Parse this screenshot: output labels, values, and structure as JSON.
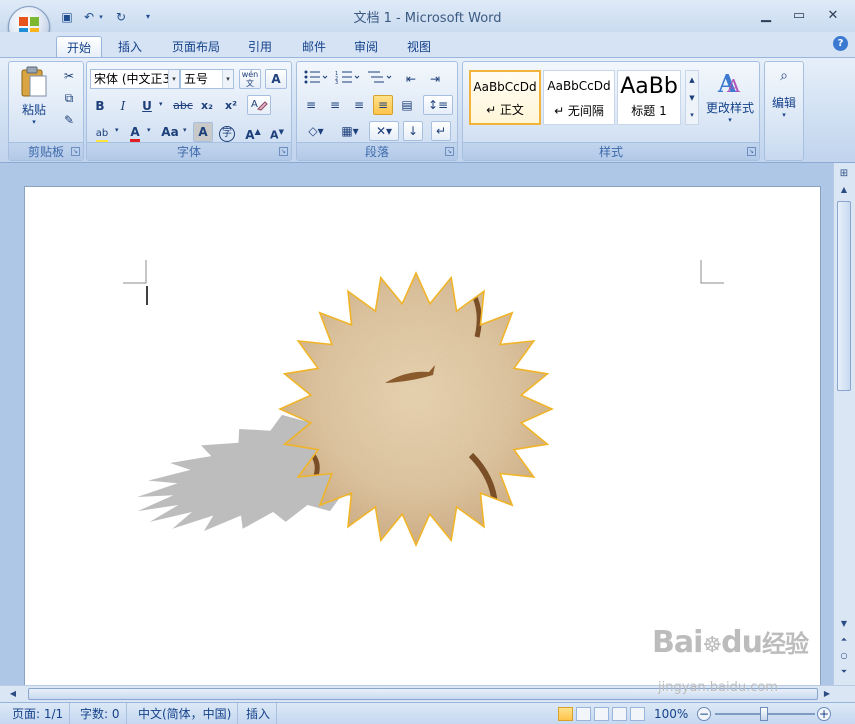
{
  "window": {
    "title": "文档 1 - Microsoft Word"
  },
  "tabs": [
    {
      "label": "开始",
      "active": true
    },
    {
      "label": "插入"
    },
    {
      "label": "页面布局"
    },
    {
      "label": "引用"
    },
    {
      "label": "邮件"
    },
    {
      "label": "审阅"
    },
    {
      "label": "视图"
    }
  ],
  "ribbon": {
    "clipboard": {
      "group_label": "剪贴板",
      "paste_label": "粘贴"
    },
    "font": {
      "group_label": "字体",
      "font_name": "宋体 (中文正3",
      "font_size": "五号",
      "bold": "B",
      "italic": "I",
      "underline": "U",
      "strike": "abc",
      "subscript": "x₂",
      "superscript": "x²",
      "grow": "A",
      "shrink": "A",
      "change_case": "Aa",
      "highlight": "ab",
      "font_color": "A",
      "char_shade": "A",
      "enclose": "字",
      "wen": "wén",
      "clear": "A"
    },
    "paragraph": {
      "group_label": "段落"
    },
    "styles": {
      "group_label": "样式",
      "cards": [
        {
          "sample": "AaBbCcDd",
          "name": "↵ 正文"
        },
        {
          "sample": "AaBbCcDd",
          "name": "↵ 无间隔"
        },
        {
          "sample": "AaBb",
          "name": "标题 1"
        }
      ],
      "change_styles": "更改样式"
    },
    "editing": {
      "label": "编辑"
    }
  },
  "statusbar": {
    "page": "页面: 1/1",
    "words": "字数: 0",
    "language": "中文(简体，中国)",
    "mode": "插入",
    "zoom": "100%"
  },
  "watermark": {
    "line1": "Bai",
    "line2": "du",
    "line3": "经验",
    "url": "jingyan.baidu.com"
  },
  "colors": {
    "accent": "#15428b",
    "highlight": "#ffe63c",
    "font_color": "#e02020",
    "shape_outline": "#f0b429",
    "shape_fill": "#e2c9a2",
    "shadow": "#bdbdbd"
  }
}
